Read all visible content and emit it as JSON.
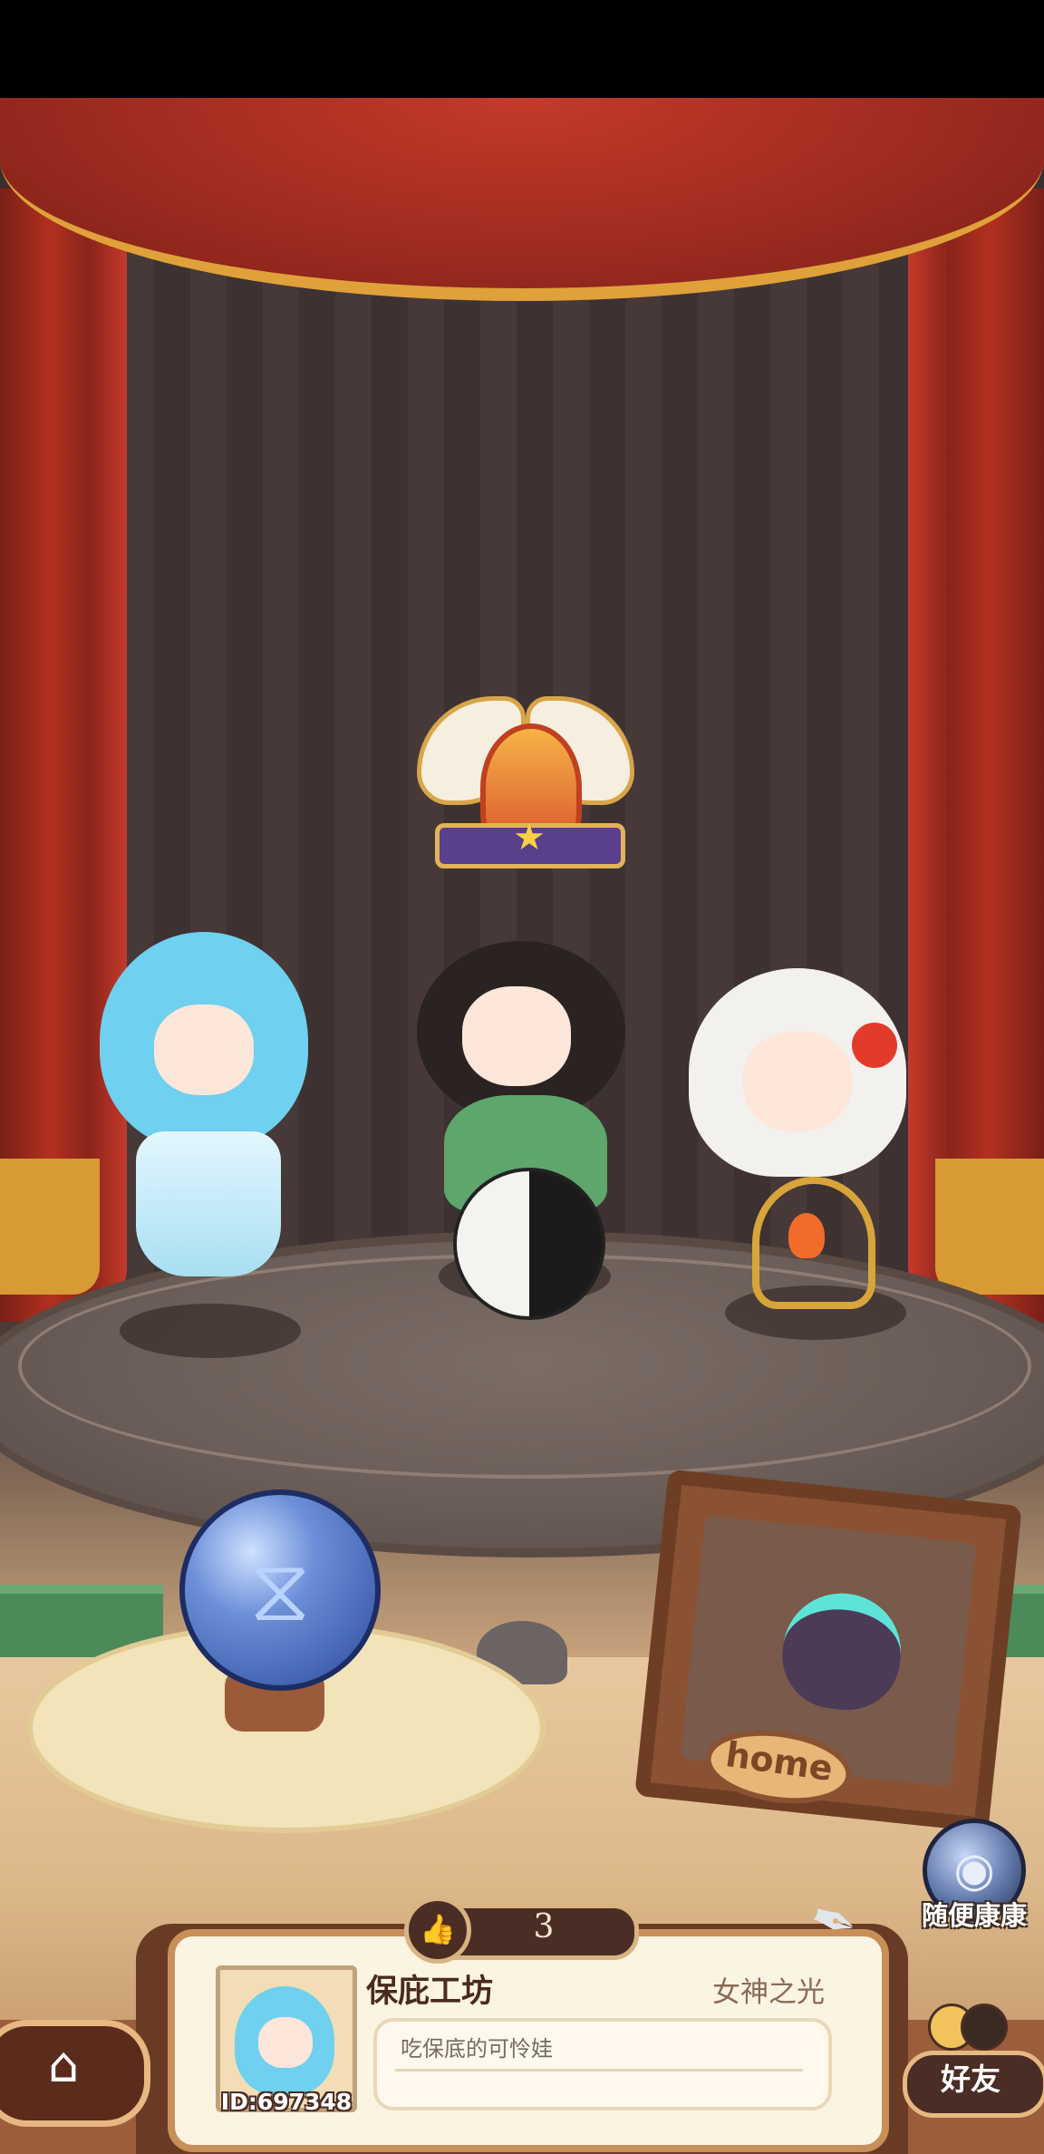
{
  "stage": {
    "home_sign": "home",
    "random_visit_label": "随便康康",
    "like_count": "3"
  },
  "profile": {
    "name": "保庇工坊",
    "title": "女神之光",
    "signature": "吃保底的可怜娃",
    "id_label": "ID:697348"
  },
  "nav": {
    "friends_label": "好友"
  },
  "icons": {
    "home": "home-icon",
    "hourglass": "hourglass-icon",
    "random": "black-hole-icon",
    "like": "thumbs-up-icon",
    "quill": "quill-icon",
    "friends": "friends-icon",
    "badge": "winged-trophy-badge-icon"
  },
  "colors": {
    "curtain": "#b1301f",
    "panel_border": "#c98f59",
    "dark_brown": "#4a2d24"
  }
}
